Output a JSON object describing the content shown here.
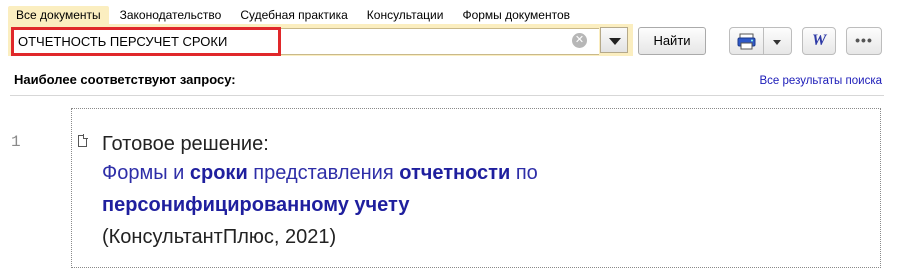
{
  "tabs": [
    {
      "label": "Все документы",
      "active": true
    },
    {
      "label": "Законодательство",
      "active": false
    },
    {
      "label": "Судебная практика",
      "active": false
    },
    {
      "label": "Консультации",
      "active": false
    },
    {
      "label": "Формы документов",
      "active": false
    }
  ],
  "search": {
    "value": "ОТЧЕТНОСТЬ ПЕРСУЧЕТ СРОКИ",
    "clear_icon": "clear-circle-icon",
    "dropdown_icon": "chevron-down-icon",
    "find_label": "Найти"
  },
  "toolbar": {
    "print_icon": "printer-icon",
    "print_dropdown_icon": "chevron-down-icon",
    "word_icon": "word-export-icon",
    "word_glyph": "W",
    "more_icon": "more-dots-icon",
    "more_glyph": "•••"
  },
  "results_header": {
    "title": "Наиболее соответствуют запросу:",
    "all_results_link": "Все результаты поиска"
  },
  "results": [
    {
      "number": "1",
      "label": "Готовое решение:",
      "title_parts": [
        {
          "text": "Формы и ",
          "bold": false
        },
        {
          "text": "сроки",
          "bold": true
        },
        {
          "text": " представления ",
          "bold": false
        },
        {
          "text": "отчетности",
          "bold": true
        },
        {
          "text": " по",
          "bold": false
        },
        {
          "text": "персонифицированному учету",
          "bold": true
        }
      ],
      "source": "(КонсультантПлюс, 2021)"
    }
  ],
  "colors": {
    "tab_active_bg": "#fbeec0",
    "search_highlight": "#e0282a",
    "link": "#1b1bb8",
    "result_title": "#2e2ea8"
  }
}
